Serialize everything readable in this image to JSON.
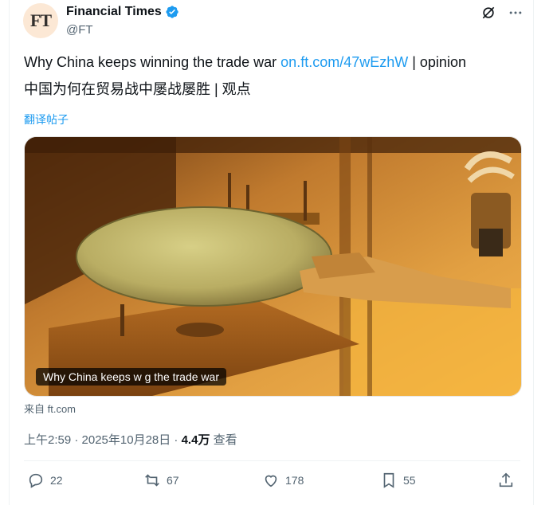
{
  "author": {
    "name": "Financial Times",
    "handle": "@FT",
    "avatar_text": "FT",
    "verified": true
  },
  "post": {
    "text_prefix": "Why China keeps winning the trade war ",
    "link_text": "on.ft.com/47wEzhW",
    "text_suffix": "  | opinion",
    "text_cn": "中国为何在贸易战中屡战屡胜 | 观点",
    "translate_label": "翻译帖子"
  },
  "card": {
    "caption": "Why China keeps w      g the trade war",
    "source": "来自 ft.com"
  },
  "meta": {
    "time": "上午2:59 · 2025年10月28日 · ",
    "views": "4.4万",
    "views_label": " 查看"
  },
  "actions": {
    "replies": "22",
    "reposts": "67",
    "likes": "178",
    "bookmarks": "55"
  },
  "colors": {
    "link": "#1d9bf0",
    "verified": "#1d9bf0",
    "muted": "#536471",
    "avatar_bg": "#fce8d5"
  },
  "icons": [
    "grok-icon",
    "more-icon",
    "reply-icon",
    "repost-icon",
    "like-icon",
    "bookmark-icon",
    "share-icon"
  ]
}
